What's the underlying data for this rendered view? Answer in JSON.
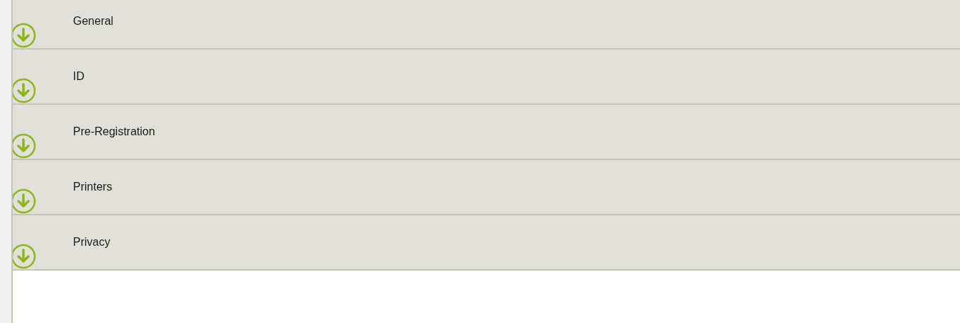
{
  "sections": [
    {
      "label": "General"
    },
    {
      "label": "ID"
    },
    {
      "label": "Pre-Registration"
    },
    {
      "label": "Printers"
    },
    {
      "label": "Privacy"
    }
  ]
}
